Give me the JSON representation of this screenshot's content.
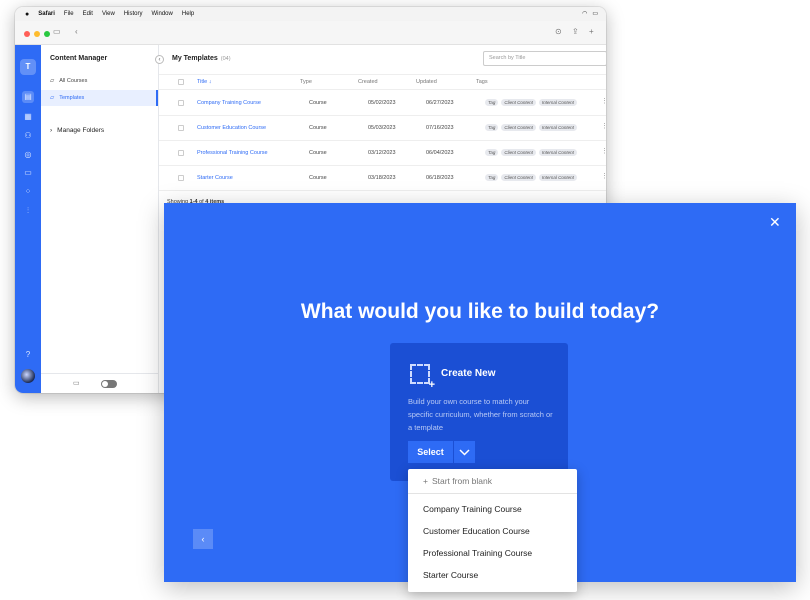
{
  "menubar": {
    "app": "Safari",
    "items": [
      "File",
      "Edit",
      "View",
      "History",
      "Window",
      "Help"
    ]
  },
  "sidebar": {
    "title": "Content Manager",
    "items": [
      {
        "label": "All Courses",
        "icon": "folder-open-icon"
      },
      {
        "label": "Templates",
        "icon": "folder-template-icon",
        "selected": true
      }
    ],
    "manage_folders": "Manage Folders"
  },
  "main": {
    "title": "My Templates",
    "count": "(04)",
    "search_placeholder": "Search by Title",
    "columns": [
      "Title ↓",
      "Type",
      "Created",
      "Updated",
      "Tags"
    ],
    "rows": [
      {
        "title": "Company Training Course",
        "type": "Course",
        "created": "05/02/2023",
        "updated": "06/27/2023",
        "tags": [
          "Tag",
          "Client Content",
          "Internal Content"
        ]
      },
      {
        "title": "Customer Education Course",
        "type": "Course",
        "created": "05/03/2023",
        "updated": "07/16/2023",
        "tags": [
          "Tag",
          "Client Content",
          "Internal Content"
        ]
      },
      {
        "title": "Professional Training Course",
        "type": "Course",
        "created": "03/12/2023",
        "updated": "06/04/2023",
        "tags": [
          "Tag",
          "Client Content",
          "Internal Content"
        ]
      },
      {
        "title": "Starter Course",
        "type": "Course",
        "created": "03/18/2023",
        "updated": "06/18/2023",
        "tags": [
          "Tag",
          "Client Content",
          "Internal Content"
        ]
      }
    ],
    "showing_prefix": "Showing ",
    "showing_range": "1-4",
    "showing_mid": " of ",
    "showing_total": "4 items"
  },
  "modal": {
    "headline": "What would you like to build today?",
    "card_title": "Create New",
    "card_desc": "Build your own course to match your specific curriculum, whether from scratch or a template",
    "select_label": "Select",
    "dropdown": {
      "blank": "Start from blank",
      "options": [
        "Company Training Course",
        "Customer Education Course",
        "Professional Training Course",
        "Starter Course"
      ]
    }
  },
  "colors": {
    "accent": "#2e6bf5",
    "card": "#1b4fd4"
  }
}
